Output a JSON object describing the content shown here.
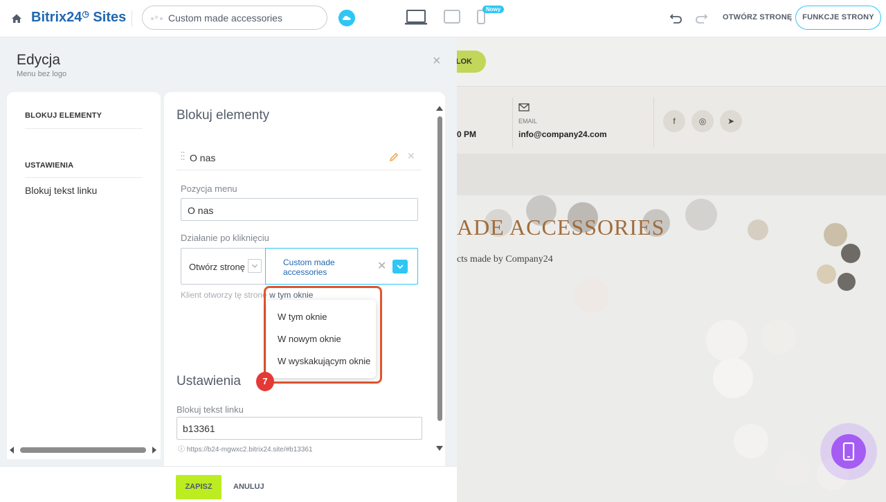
{
  "topbar": {
    "logo_main": "Bitrix24",
    "logo_sites": "Sites",
    "site_name": "Custom made accessories",
    "new_badge": "Nowy",
    "open_page": "OTWÓRZ STRONĘ",
    "page_functions": "FUNKCJE STRONY",
    "icons": [
      "home-icon",
      "cloud-icon",
      "laptop-icon",
      "tablet-icon",
      "phone-icon",
      "undo-icon",
      "redo-icon"
    ]
  },
  "editor": {
    "title": "Edycja",
    "subtitle": "Menu bez logo",
    "close": "×",
    "sidebar": {
      "items": [
        "BLOKUJ ELEMENTY",
        "USTAWIENIA",
        "Blokuj tekst linku"
      ]
    },
    "main": {
      "title": "Blokuj elementy",
      "item_name": "O nas",
      "menu_position_label": "Pozycja menu",
      "menu_position_value": "O nas",
      "action_label": "Działanie po kliknięciu",
      "action_type": "Otwórz stronę",
      "action_target": "Custom made accessories",
      "hint_prefix": "Klient otworzy tę stronę",
      "hint_value": "w tym oknie",
      "settings_title": "Ustawienia",
      "link_label": "Blokuj tekst linku",
      "link_value": "b13361",
      "link_url": "https://b24-mgwxc2.bitrix24.site/#b13361"
    },
    "dropdown": {
      "options": [
        "W tym oknie",
        "W nowym oknie",
        "W wyskakującym oknie"
      ]
    },
    "step_badge": "7",
    "footer": {
      "save": "ZAPISZ",
      "cancel": "ANULUJ"
    }
  },
  "preview": {
    "button_text": "LOK",
    "time_partial": "0 PM",
    "email_label": "EMAIL",
    "email": "info@company24.com",
    "social": [
      "f",
      "◎",
      "➤"
    ],
    "hero_title": "ADE ACCESSORIES",
    "hero_subtitle": "cts made by Company24"
  },
  "colors": {
    "accent": "#2fc6f6",
    "brand_dark": "#2067b0",
    "save_green": "#bbed21",
    "highlight_orange": "#e2552e",
    "badge_red": "#e53935",
    "fab_purple": "#a55cf3"
  }
}
